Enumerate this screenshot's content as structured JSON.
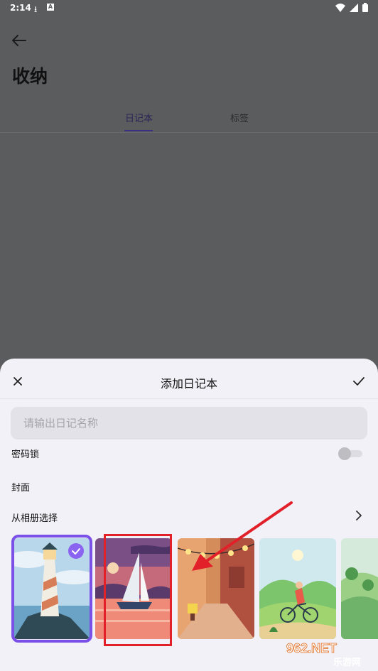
{
  "status": {
    "time": "2:14"
  },
  "header": {
    "title": "收纳"
  },
  "tabs": [
    {
      "label": "日记本"
    },
    {
      "label": "标签"
    }
  ],
  "sheet": {
    "title": "添加日记本",
    "name_placeholder": "请输出日记名称",
    "name_value": "",
    "password_label": "密码锁",
    "password_enabled": false,
    "cover_label": "封面",
    "album_label": "从相册选择",
    "covers": [
      {
        "name": "lighthouse",
        "selected": true
      },
      {
        "name": "sailboat",
        "selected": false
      },
      {
        "name": "street-lights",
        "selected": false
      },
      {
        "name": "cyclist",
        "selected": false
      },
      {
        "name": "green-hills",
        "selected": false
      }
    ]
  },
  "watermark": {
    "text": "962.NET",
    "sub": "乐游网"
  },
  "colors": {
    "accent": "#7a50e8",
    "annotation": "#e2202a",
    "sheet_bg": "#f1f1f7"
  }
}
